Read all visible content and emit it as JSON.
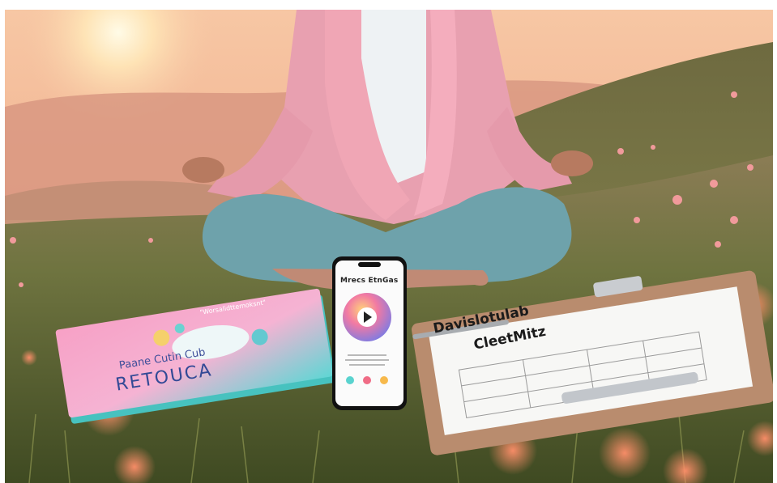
{
  "photo": {
    "description_icon": "meditation-photo",
    "corner_badge": "",
    "phone_screen_title": "Mrecs EtnGas",
    "clipboard_title_line1": "Davislotulab",
    "clipboard_title_line2": "CleetMitz",
    "brochure_top_text": "\"Worsalidttemoksnt\"",
    "brochure_line1": "Paane Cutin Cub",
    "brochure_line2": "RETOUCA"
  },
  "colors": {
    "sky": "#f4b48c",
    "hill": "#6b6a3f",
    "grass": "#5f6b34",
    "cardigan": "#e9a2b0",
    "pants": "#6fa1a8",
    "brochure_pink": "#f39fc4",
    "brochure_teal": "#5fd4d2",
    "clipboard": "#b98c6e"
  }
}
